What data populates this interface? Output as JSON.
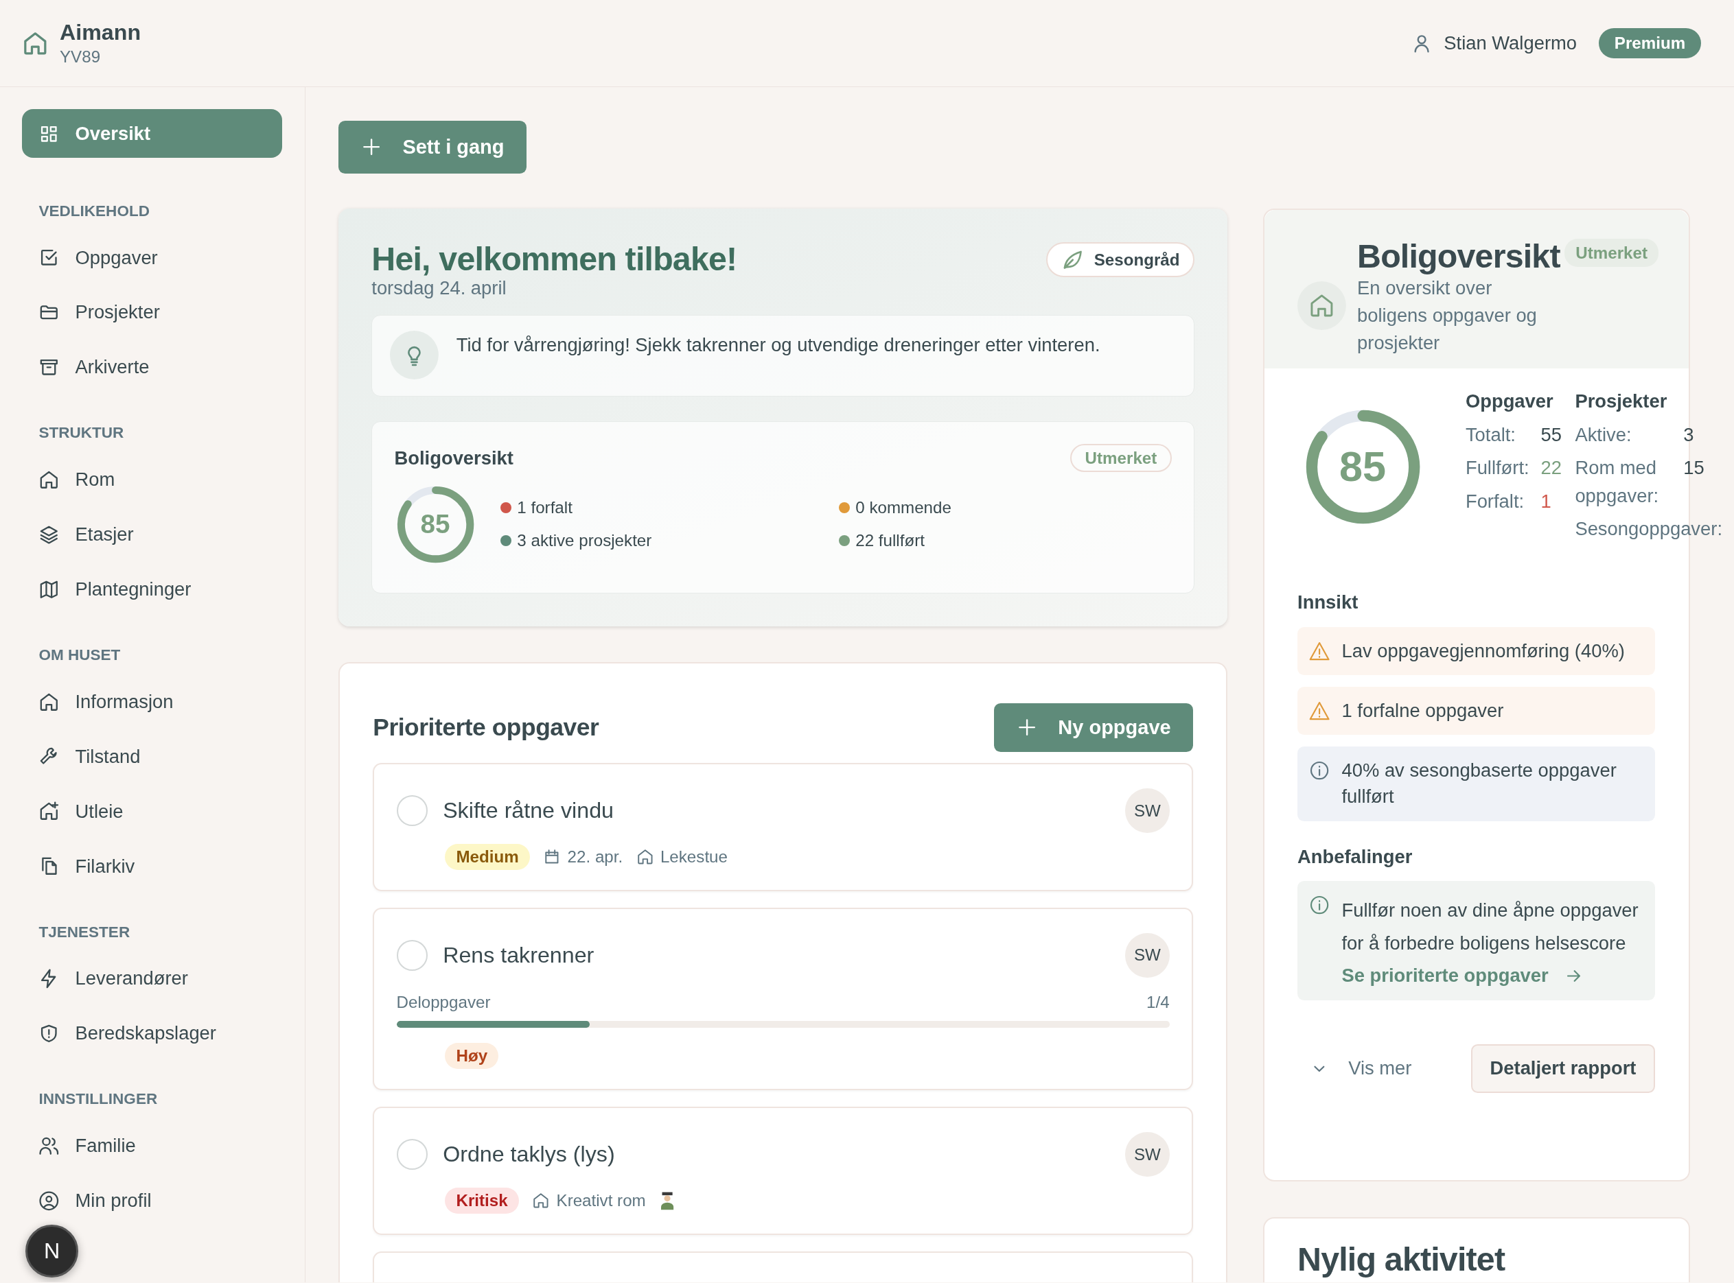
{
  "header": {
    "brand": "Aimann",
    "code": "YV89",
    "user": "Stian Walgermo",
    "plan": "Premium"
  },
  "sidebar": {
    "top": {
      "label": "Oversikt",
      "selected": true
    },
    "sections": [
      {
        "title": "VEDLIKEHOLD",
        "items": [
          {
            "label": "Oppgaver",
            "selected": false
          },
          {
            "label": "Prosjekter",
            "selected": false
          },
          {
            "label": "Arkiverte",
            "selected": false
          }
        ]
      },
      {
        "title": "STRUKTUR",
        "items": [
          {
            "label": "Rom",
            "selected": false
          },
          {
            "label": "Etasjer",
            "selected": false
          },
          {
            "label": "Plantegninger",
            "selected": false
          }
        ]
      },
      {
        "title": "OM HUSET",
        "items": [
          {
            "label": "Informasjon",
            "selected": false
          },
          {
            "label": "Tilstand",
            "selected": false
          },
          {
            "label": "Utleie",
            "selected": false
          },
          {
            "label": "Filarkiv",
            "selected": false
          }
        ]
      },
      {
        "title": "TJENESTER",
        "items": [
          {
            "label": "Leverandører",
            "selected": false
          },
          {
            "label": "Beredskapslager",
            "selected": false
          }
        ]
      },
      {
        "title": "INNSTILLINGER",
        "items": [
          {
            "label": "Familie",
            "selected": false
          },
          {
            "label": "Min profil",
            "selected": false
          }
        ]
      }
    ],
    "dev_badge": "N"
  },
  "start_button": "Sett i gang",
  "welcome": {
    "title": "Hei, velkommen tilbake!",
    "date": "torsdag 24. april",
    "badge": "Sesongråd",
    "tip": "Tid for vårrengjøring! Sjekk takrenner og utvendige dreneringer etter vinteren.",
    "overview": {
      "title": "Boligoversikt",
      "rating": "Utmerket",
      "score": "85",
      "level": 0.85,
      "stats": [
        {
          "text": "1 forfalt",
          "color": "#d0574b"
        },
        {
          "text": "0 kommende",
          "color": "#e09a3a"
        },
        {
          "text": "3 aktive prosjekter",
          "color": "#5f8b7a"
        },
        {
          "text": "22 fullført",
          "color": "#7ba07f"
        }
      ]
    }
  },
  "tasks": {
    "title": "Prioriterte oppgaver",
    "new_button": "Ny oppgave",
    "items": [
      {
        "title": "Skifte råtne vindu",
        "checked": false,
        "assignee": "SW",
        "priority": {
          "text": "Medium",
          "kind": "medium"
        },
        "date": "22. apr.",
        "room": "Lekestue"
      },
      {
        "title": "Rens takrenner",
        "checked": false,
        "assignee": "SW",
        "subtasks": {
          "label": "Deloppgaver",
          "count": "1/4",
          "level": 0.25
        },
        "priority": {
          "text": "Høy",
          "kind": "high"
        }
      },
      {
        "title": "Ordne taklys (lys)",
        "checked": false,
        "assignee": "SW",
        "priority": {
          "text": "Kritisk",
          "kind": "critical"
        },
        "room": "Kreativt rom",
        "room_figure": true
      }
    ]
  },
  "summary": {
    "title": "Boligoversikt",
    "rating": "Utmerket",
    "subtitle": "En oversikt over boligens oppgaver og prosjekter",
    "score": "85",
    "level": 0.85,
    "columns": [
      {
        "heading": "Oppgaver",
        "rows": [
          {
            "label": "Totalt:",
            "value": "55",
            "kind": "plain"
          },
          {
            "label": "Fullført:",
            "value": "22",
            "kind": "good"
          },
          {
            "label": "Forfalt:",
            "value": "1",
            "kind": "bad"
          }
        ]
      },
      {
        "heading": "Prosjekter",
        "rows": [
          {
            "label": "Aktive:",
            "value": "3",
            "kind": "plain"
          },
          {
            "label": "Rom med oppgaver:",
            "value": "15",
            "kind": "plain"
          },
          {
            "label": "Sesongoppgaver:"
          }
        ]
      }
    ],
    "insights_title": "Innsikt",
    "insights": [
      {
        "text": "Lav oppgavegjennomføring (40%)",
        "kind": "warning"
      },
      {
        "text": "1 forfalne oppgaver",
        "kind": "warning"
      },
      {
        "text": "40% av sesongbaserte oppgaver fullført",
        "kind": "info"
      }
    ],
    "recommendations_title": "Anbefalinger",
    "recommendations": [
      {
        "text": "Fullfør noen av dine åpne oppgaver for å forbedre boligens helsescore",
        "link": "Se prioriterte oppgaver"
      }
    ],
    "more_button": "Vis mer",
    "report_button": "Detaljert rapport"
  },
  "activity": {
    "title": "Nylig aktivitet"
  }
}
